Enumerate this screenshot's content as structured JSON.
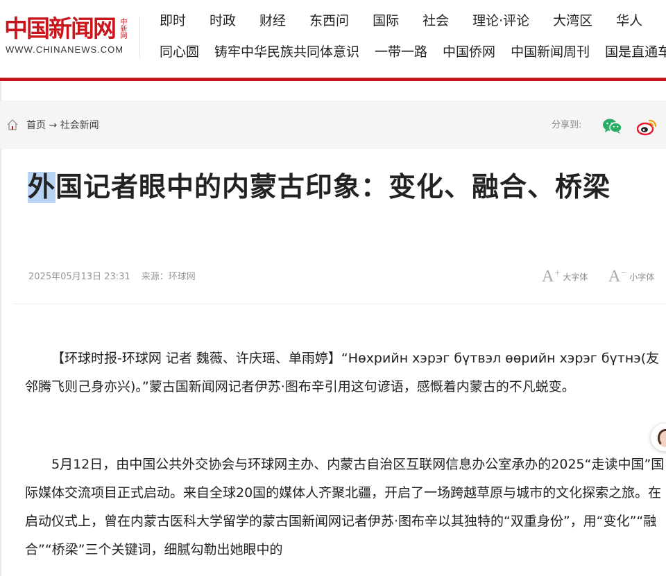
{
  "header": {
    "logo_text": "中国新闻网",
    "logo_tag": "中新网",
    "logo_url": "WWW.CHINANEWS.COM",
    "nav_row1": [
      "即时",
      "时政",
      "财经",
      "东西问",
      "国际",
      "社会",
      "理论·评论",
      "大湾区",
      "华人"
    ],
    "nav_row2": [
      "同心圆",
      "铸牢中华民族共同体意识",
      "一带一路",
      "中国侨网",
      "中国新闻周刊",
      "国是直通车"
    ]
  },
  "breadcrumb": {
    "home": "首页",
    "arrow": "→",
    "section": "社会新闻"
  },
  "share": {
    "label": "分享到:"
  },
  "article": {
    "title_selected": "外",
    "title_rest": "国记者眼中的内蒙古印象：变化、融合、桥梁",
    "date": "2025年05月13日 23:31",
    "source": "来源：环球网",
    "font_big_label": "大字体",
    "font_small_label": "小字体",
    "paragraphs": [
      "【环球时报-环球网 记者 魏薇、许庆瑶、单雨婷】“Нөхрийн хэрэг бүтвэл өөрийн хэрэг бүтнэ(友邻腾飞则己身亦兴)。”蒙古国新闻网记者伊苏·图布辛引用这句谚语，感慨着内蒙古的不凡蜕变。",
      "5月12日，由中国公共外交协会与环球网主办、内蒙古自治区互联网信息办公室承办的2025“走读中国”国际媒体交流项目正式启动。来自全球20国的媒体人齐聚北疆，开启了一场跨越草原与城市的文化探索之旅。在启动仪式上，曾在内蒙古医科大学留学的蒙古国新闻网记者伊苏·图布辛以其独特的“双重身份”，用“变化”“融合”“桥梁”三个关键词，细腻勾勒出她眼中的"
    ]
  },
  "colors": {
    "brand_red": "#c4161c",
    "selection": "#b9d4f3",
    "wechat_green": "#2aae67",
    "weibo_red": "#e6162d"
  }
}
